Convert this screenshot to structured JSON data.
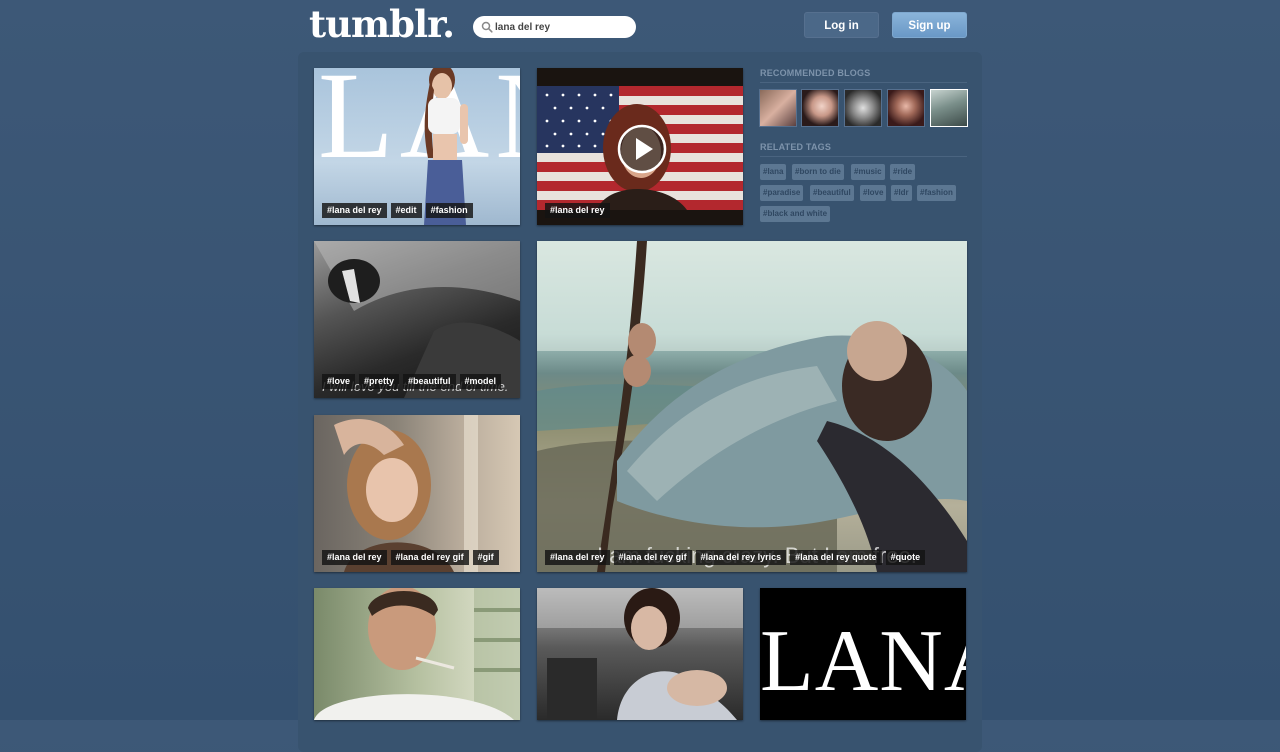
{
  "header": {
    "logo": "tumblr.",
    "search_value": "lana del rey",
    "login_label": "Log in",
    "signup_label": "Sign up"
  },
  "sidebar": {
    "recommended_title": "RECOMMENDED BLOGS",
    "related_title": "RELATED TAGS",
    "related_tags": [
      "#lana",
      "#born to die",
      "#music",
      "#ride",
      "#paradise",
      "#beautiful",
      "#love",
      "#ldr",
      "#fashion",
      "#black and white"
    ]
  },
  "posts": [
    {
      "tags": [
        "#lana del rey",
        "#edit",
        "#fashion"
      ],
      "overlay": "LANA"
    },
    {
      "tags": [
        "#lana del rey"
      ]
    },
    {
      "tags": [
        "#love",
        "#pretty",
        "#beautiful",
        "#model"
      ],
      "caption": "I will love you till the end of time."
    },
    {
      "tags": [
        "#lana del rey",
        "#lana del rey gif",
        "#gif"
      ]
    },
    {
      "tags": [
        "#lana del rey",
        "#lana del rey gif",
        "#lana del rey lyrics",
        "#lana del rey quote",
        "#quote"
      ],
      "caption": "I am fucking crazy. But I am free."
    },
    {
      "tags": []
    },
    {
      "tags": []
    },
    {
      "tags": [],
      "overlay": "LANA"
    }
  ],
  "colors": {
    "background": "#3d5877",
    "accent": "#7ea8cf"
  }
}
